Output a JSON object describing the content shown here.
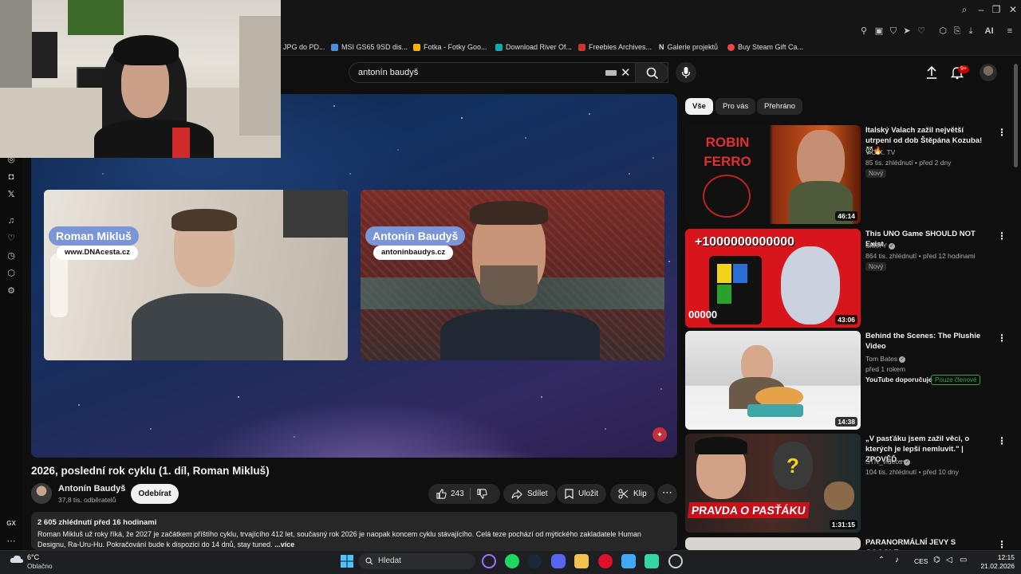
{
  "browser": {
    "bookmarks": [
      {
        "label": "JPG do PD...",
        "color": "#e33"
      },
      {
        "label": "MSI GS65 9SD dis...",
        "color": "#4a8fd8"
      },
      {
        "label": "Fotka - Fotky Goo...",
        "color": "#f4b400"
      },
      {
        "label": "Download River Of...",
        "color": "#1aa"
      },
      {
        "label": "Freebies Archives...",
        "color": "#c33"
      },
      {
        "label": "Galerie projektů",
        "color": "#fff"
      },
      {
        "label": "Buy Steam Gift Ca...",
        "color": "#e44"
      }
    ],
    "toolbar_ai": "AI"
  },
  "header": {
    "search_value": "antonín baudyš",
    "notification_badge": "9+"
  },
  "player": {
    "left_guest": {
      "name": "Roman Mikluš",
      "url": "www.DNAcesta.cz"
    },
    "right_guest": {
      "name": "Antonín Baudyš",
      "url": "antoninbaudys.cz"
    }
  },
  "video": {
    "title": "2026, poslední rok cyklu (1. díl, Roman Mikluš)",
    "channel": "Antonín Baudyš",
    "subscribers": "37,8 tis. odběratelů",
    "subscribe_label": "Odebírat",
    "likes": "243",
    "share_label": "Sdílet",
    "save_label": "Uložit",
    "clip_label": "Klip",
    "views_and_time": "2 605 zhlédnutí  před 16 hodinami",
    "description": "Roman Mikluš už roky říká, že 2027 je začátkem příštího cyklu, trvajícího 412 let, současný rok 2026 je naopak koncem cyklu stávajícího. Celá teze pochází od mýtického zakladatele Human Designu, Ra-Uru-Hu. Pokračování bude k dispozici do 14 dnů, stay tuned.",
    "more_label": "...více"
  },
  "chips": [
    "Vše",
    "Pro vás",
    "Přehráno"
  ],
  "recommendations": [
    {
      "title": "Italský Valach zažil největší utrpení od dob Štěpána Kozuba! 😈🔥",
      "channel": "V.O.X. TV",
      "meta": "85 tis. zhlédnutí • před 2 dny",
      "badge": "Nový",
      "duration": "46:14",
      "thumb_text": "ROBIN FERRO"
    },
    {
      "title": "This UNO Game SHOULD NOT Exist",
      "channel": "SMii7Y",
      "meta": "864 tis. zhlédnutí • před 12 hodinami",
      "badge": "Nový",
      "duration": "43:06",
      "thumb_text": "+1000000000000",
      "thumb_text2": "00000"
    },
    {
      "title": "Behind the Scenes: The Plushie Video",
      "channel": "Tom Bates",
      "meta": "před 1 rokem",
      "recommend": "YouTube doporučuje",
      "members": "Pouze členové",
      "duration": "14:38"
    },
    {
      "title": "„V pasťáku jsem zažil věci, o kterých je lepší nemluvit.\" | ZPOVĚĎ ...",
      "channel": "STN_videos",
      "meta": "104 tis. zhlédnutí • před 10 dny",
      "duration": "1:31:15",
      "thumb_text": "PRAVDA O PASŤÁKU"
    },
    {
      "title": "PARANORMÁLNÍ JEVY S GOOGLE"
    }
  ],
  "taskbar": {
    "temp": "6°C",
    "weather": "Oblačno",
    "search_label": "Hledat",
    "lang": "CES",
    "time": "12:15",
    "date": "21.02.2026"
  }
}
